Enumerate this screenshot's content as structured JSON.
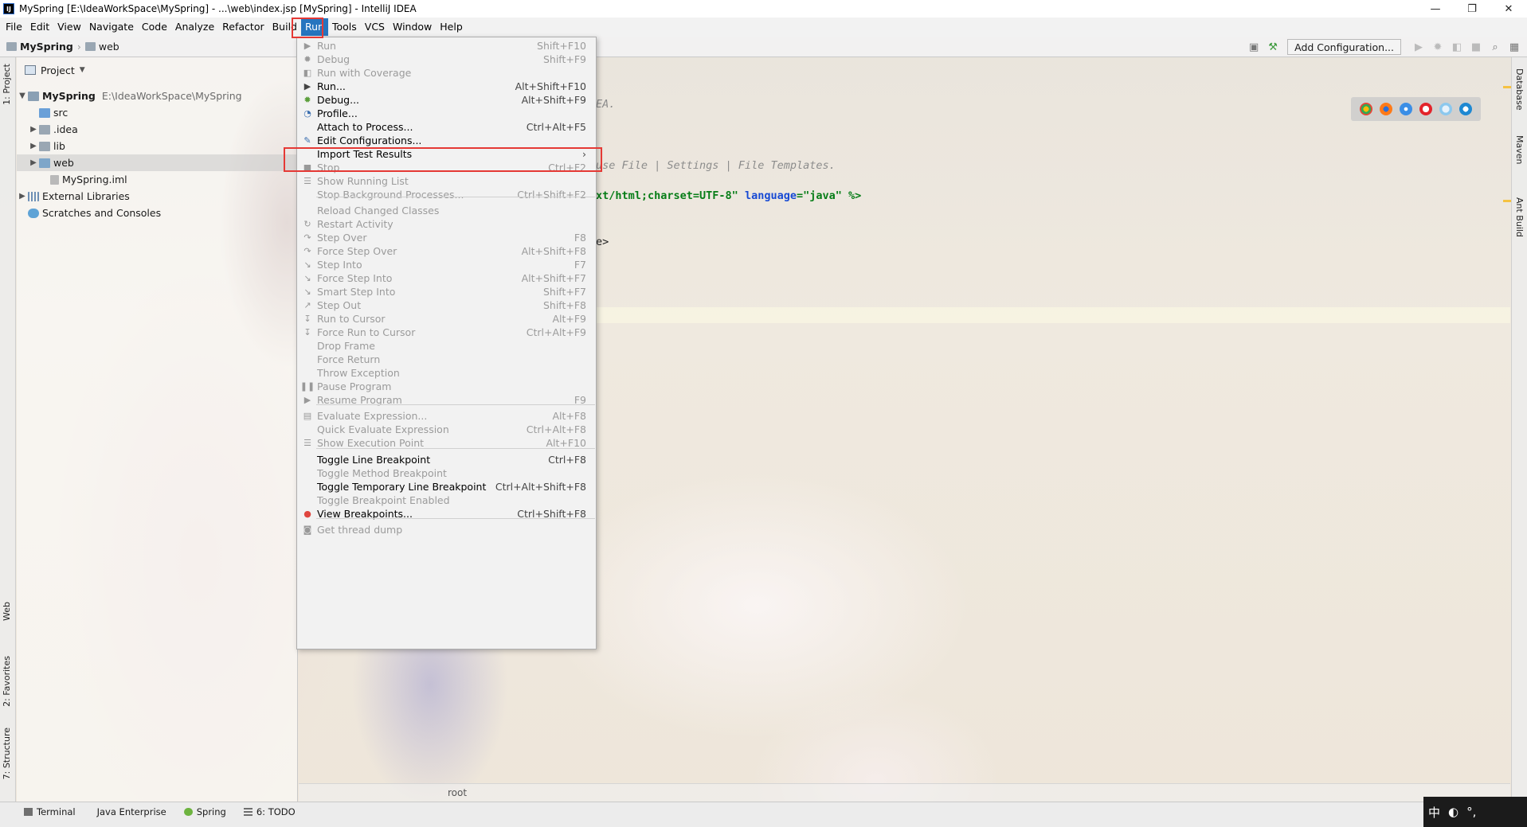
{
  "window": {
    "title": "MySpring [E:\\IdeaWorkSpace\\MySpring] - ...\\web\\index.jsp [MySpring] - IntelliJ IDEA",
    "minimize": "—",
    "restore": "❐",
    "close": "✕"
  },
  "menubar": {
    "items": [
      "File",
      "Edit",
      "View",
      "Navigate",
      "Code",
      "Analyze",
      "Refactor",
      "Build",
      "Run",
      "Tools",
      "VCS",
      "Window",
      "Help"
    ]
  },
  "navbar": {
    "project": "MySpring",
    "folder": "web",
    "add_configuration": "Add Configuration..."
  },
  "project_panel": {
    "title": "Project",
    "root_name": "MySpring",
    "root_path": "E:\\IdeaWorkSpace\\MySpring",
    "items": [
      "src",
      ".idea",
      "lib",
      "web",
      "MySpring.iml",
      "External Libraries",
      "Scratches and Consoles"
    ]
  },
  "side_tabs": {
    "left": [
      "1: Project",
      "Web",
      "2: Favorites",
      "7: Structure"
    ],
    "right": [
      "Database",
      "Maven",
      "Ant Build"
    ]
  },
  "editor": {
    "line1": "EA.",
    "line2": "use File | Settings | File Templates.",
    "line3_a": "xt/html;charset=UTF-8\"",
    "line3_b": "language",
    "line3_c": "=\"java\" %>",
    "line4": "e>",
    "breadcrumb": "root"
  },
  "run_menu": {
    "items": [
      {
        "label": "Run",
        "shortcut": "Shift+F10",
        "enabled": false,
        "icon": "run-icon"
      },
      {
        "label": "Debug",
        "shortcut": "Shift+F9",
        "enabled": false,
        "icon": "debug-icon"
      },
      {
        "label": "Run with Coverage",
        "shortcut": "",
        "enabled": false,
        "icon": "coverage-icon"
      },
      {
        "label": "Run...",
        "shortcut": "Alt+Shift+F10",
        "enabled": true,
        "icon": "run-icon"
      },
      {
        "label": "Debug...",
        "shortcut": "Alt+Shift+F9",
        "enabled": true,
        "icon": "debug-icon"
      },
      {
        "label": "Profile...",
        "shortcut": "",
        "enabled": true,
        "icon": "profile-icon"
      },
      {
        "label": "Attach to Process...",
        "shortcut": "Ctrl+Alt+F5",
        "enabled": true,
        "icon": ""
      },
      {
        "label": "Edit Configurations...",
        "shortcut": "",
        "enabled": true,
        "icon": "edit-icon"
      },
      {
        "label": "Import Test Results",
        "shortcut": "›",
        "enabled": true,
        "icon": ""
      },
      {
        "label": "Stop",
        "shortcut": "Ctrl+F2",
        "enabled": false,
        "icon": "stop-icon"
      },
      {
        "label": "Show Running List",
        "shortcut": "",
        "enabled": false,
        "icon": "list-icon"
      },
      {
        "label": "Stop Background Processes...",
        "shortcut": "Ctrl+Shift+F2",
        "enabled": false,
        "icon": ""
      },
      {
        "label": "Reload Changed Classes",
        "shortcut": "",
        "enabled": false,
        "icon": ""
      },
      {
        "label": "Restart Activity",
        "shortcut": "",
        "enabled": false,
        "icon": "restart-icon"
      },
      {
        "label": "Step Over",
        "shortcut": "F8",
        "enabled": false,
        "icon": "step-over-icon"
      },
      {
        "label": "Force Step Over",
        "shortcut": "Alt+Shift+F8",
        "enabled": false,
        "icon": "step-over-icon"
      },
      {
        "label": "Step Into",
        "shortcut": "F7",
        "enabled": false,
        "icon": "step-into-icon"
      },
      {
        "label": "Force Step Into",
        "shortcut": "Alt+Shift+F7",
        "enabled": false,
        "icon": "step-into-icon"
      },
      {
        "label": "Smart Step Into",
        "shortcut": "Shift+F7",
        "enabled": false,
        "icon": "step-into-icon"
      },
      {
        "label": "Step Out",
        "shortcut": "Shift+F8",
        "enabled": false,
        "icon": "step-out-icon"
      },
      {
        "label": "Run to Cursor",
        "shortcut": "Alt+F9",
        "enabled": false,
        "icon": "cursor-icon"
      },
      {
        "label": "Force Run to Cursor",
        "shortcut": "Ctrl+Alt+F9",
        "enabled": false,
        "icon": "cursor-icon"
      },
      {
        "label": "Drop Frame",
        "shortcut": "",
        "enabled": false,
        "icon": ""
      },
      {
        "label": "Force Return",
        "shortcut": "",
        "enabled": false,
        "icon": ""
      },
      {
        "label": "Throw Exception",
        "shortcut": "",
        "enabled": false,
        "icon": ""
      },
      {
        "label": "Pause Program",
        "shortcut": "",
        "enabled": false,
        "icon": "pause-icon"
      },
      {
        "label": "Resume Program",
        "shortcut": "F9",
        "enabled": false,
        "icon": "resume-icon"
      },
      {
        "label": "Evaluate Expression...",
        "shortcut": "Alt+F8",
        "enabled": false,
        "icon": "calc-icon"
      },
      {
        "label": "Quick Evaluate Expression",
        "shortcut": "Ctrl+Alt+F8",
        "enabled": false,
        "icon": ""
      },
      {
        "label": "Show Execution Point",
        "shortcut": "Alt+F10",
        "enabled": false,
        "icon": "list-icon"
      },
      {
        "label": "Toggle Line Breakpoint",
        "shortcut": "Ctrl+F8",
        "enabled": true,
        "icon": ""
      },
      {
        "label": "Toggle Method Breakpoint",
        "shortcut": "",
        "enabled": false,
        "icon": ""
      },
      {
        "label": "Toggle Temporary Line Breakpoint",
        "shortcut": "Ctrl+Alt+Shift+F8",
        "enabled": true,
        "icon": ""
      },
      {
        "label": "Toggle Breakpoint Enabled",
        "shortcut": "",
        "enabled": false,
        "icon": ""
      },
      {
        "label": "View Breakpoints...",
        "shortcut": "Ctrl+Shift+F8",
        "enabled": true,
        "icon": "breakpoint-icon"
      },
      {
        "label": "Get thread dump",
        "shortcut": "",
        "enabled": false,
        "icon": "camera-icon"
      }
    ]
  },
  "bottom_tabs": [
    "Terminal",
    "Java Enterprise",
    "Spring",
    "6: TODO"
  ],
  "ime": {
    "label": "中"
  },
  "colors": {
    "menu_active": "#2675bf",
    "highlight_box": "#e53935"
  }
}
